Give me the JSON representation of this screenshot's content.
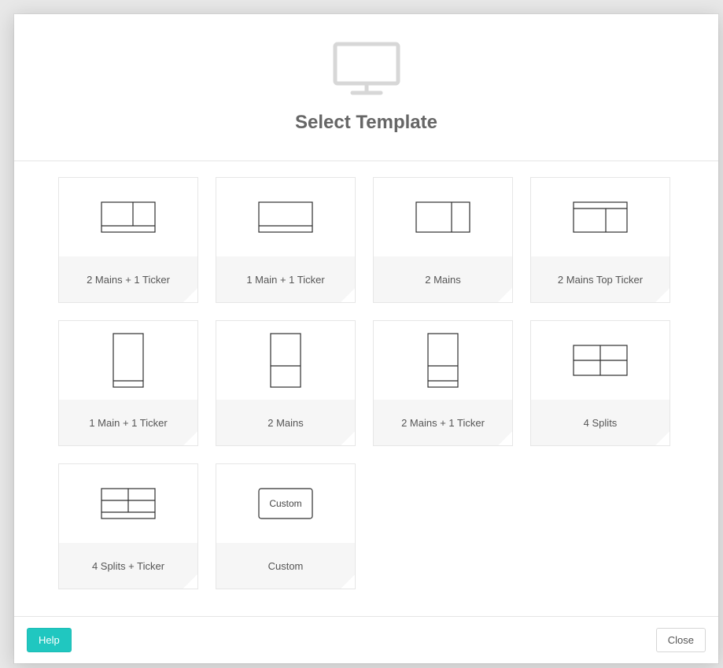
{
  "modal": {
    "title": "Select Template",
    "help_label": "Help",
    "close_label": "Close"
  },
  "templates": [
    {
      "label": "2 Mains + 1 Ticker",
      "icon": "h-2mains-ticker"
    },
    {
      "label": "1 Main + 1 Ticker",
      "icon": "h-1main-ticker"
    },
    {
      "label": "2 Mains",
      "icon": "h-2mains"
    },
    {
      "label": "2 Mains Top Ticker",
      "icon": "h-topticker-2mains"
    },
    {
      "label": "1 Main + 1 Ticker",
      "icon": "v-1main-ticker"
    },
    {
      "label": "2 Mains",
      "icon": "v-2mains"
    },
    {
      "label": "2 Mains + 1 Ticker",
      "icon": "v-2mains-ticker"
    },
    {
      "label": "4 Splits",
      "icon": "h-4splits"
    },
    {
      "label": "4 Splits + Ticker",
      "icon": "h-4splits-ticker"
    },
    {
      "label": "Custom",
      "icon": "custom",
      "inner_text": "Custom"
    }
  ]
}
